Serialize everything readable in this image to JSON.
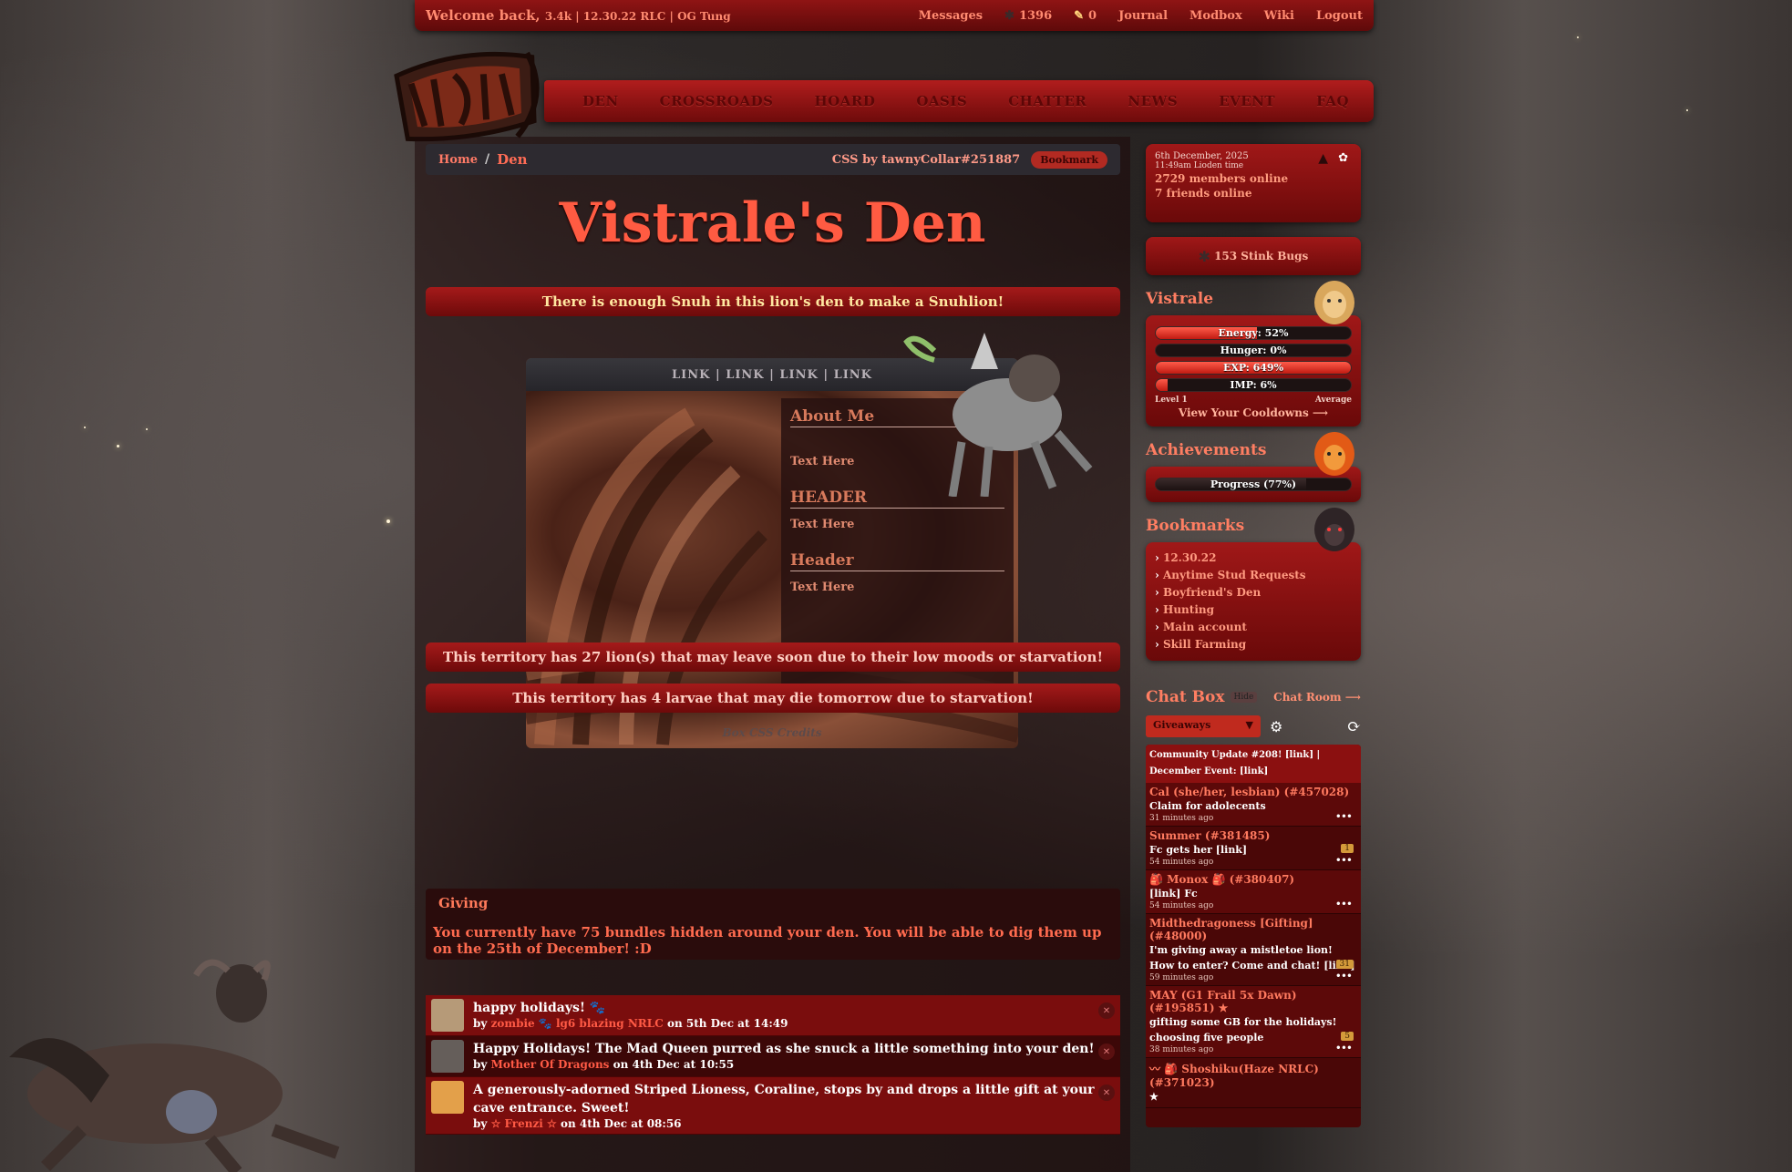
{
  "topbar": {
    "welcome": "Welcome back,",
    "welcome_detail": "3.4k | 12.30.22 RLC | OG Tung",
    "messages": "Messages",
    "stat_count": "1396",
    "feather_count": "0",
    "journal": "Journal",
    "modbox": "Modbox",
    "wiki": "Wiki",
    "logout": "Logout"
  },
  "nav": {
    "items": [
      "DEN",
      "CROSSROADS",
      "HOARD",
      "OASIS",
      "CHATTER",
      "NEWS",
      "EVENT",
      "FAQ"
    ]
  },
  "breadcrumb": {
    "home": "Home",
    "separator": "/",
    "current": "Den",
    "credit": "CSS by tawnyCollar#251887",
    "bookmark": "Bookmark"
  },
  "den": {
    "title": "Vistrale's Den",
    "banner_snuh": "There is enough Snuh in this lion's den to make a Snuhlion!",
    "linkbar": "LINK | LINK | LINK | LINK",
    "panel": {
      "h1": "About Me",
      "t1": "Text Here",
      "h2": "HEADER",
      "t2": "Text Here",
      "h3": "Header",
      "t3": "Text Here"
    },
    "box_credits": "Box CSS Credits",
    "warning_lions": "This territory has 27 lion(s) that may leave soon due to their low moods or starvation!",
    "warning_larvae": "This territory has 4 larvae that may die tomorrow due to starvation!"
  },
  "giving": {
    "title": "Giving",
    "text": "You currently have 75 bundles hidden around your den. You will be able to dig them up on the 25th of December! :D"
  },
  "gift_log": [
    {
      "msg": "happy holidays! 🐾",
      "by": "by",
      "who": "zombie 🐾 lg6 blazing NRLC",
      "when": "on 5th Dec at 14:49"
    },
    {
      "msg": "Happy Holidays! The Mad Queen purred as she snuck a little something into your den!",
      "by": "by",
      "who": "Mother Of Dragons",
      "when": "on 4th Dec at 10:55"
    },
    {
      "msg": "A generously-adorned Striped Lioness, Coraline, stops by and drops a little gift at your cave entrance. Sweet!",
      "by": "by",
      "who": "☆ Frenzi ☆",
      "when": "on 4th Dec at 08:56"
    }
  ],
  "sidebar": {
    "date": "6th December, 2025",
    "time": "11:49am Lioden time",
    "members_online": "2729 members online",
    "friends_online": "7 friends online",
    "stink_bugs": "153 Stink Bugs",
    "lion_name": "Vistrale",
    "bars": [
      {
        "label": "Energy: 52%",
        "pct": 52
      },
      {
        "label": "Hunger: 0%",
        "pct": 0
      },
      {
        "label": "EXP: 649%",
        "pct": 100
      },
      {
        "label": "IMP: 6%",
        "pct": 6
      }
    ],
    "level_left": "Level 1",
    "level_right": "Average",
    "cooldowns": "View Your Cooldowns ⟶",
    "achievements_title": "Achievements",
    "achievements_bar": {
      "label": "Progress (77%)",
      "pct": 77
    },
    "bookmarks_title": "Bookmarks",
    "bookmarks": [
      "12.30.22",
      "Anytime Stud Requests",
      "Boyfriend's Den",
      "Hunting",
      "Main account",
      "Skill Farming"
    ],
    "chat": {
      "title": "Chat Box",
      "hide": "Hide",
      "room": "Chat Room ⟶",
      "channel": "Giveaways",
      "update": "Community Update #208! [link] | December Event: [link]",
      "messages": [
        {
          "name": "Cal (she/her, lesbian) (#457028)",
          "text": "Claim for adolecents",
          "ago": "31 minutes ago",
          "tag": ""
        },
        {
          "name": "Summer (#381485)",
          "text": "Fc gets her [link]",
          "ago": "54 minutes ago",
          "tag": "1"
        },
        {
          "name": "🎒 Monox 🎒 (#380407)",
          "text": "[link] Fc",
          "ago": "54 minutes ago",
          "tag": ""
        },
        {
          "name": "Midthedragoness [Gifting] (#48000)",
          "text": "I'm giving away a mistletoe lion! How to enter? Come and chat! [link]",
          "ago": "59 minutes ago",
          "tag": "31"
        },
        {
          "name": "MAY (G1 Frail 5x Dawn) (#195851) ★",
          "text": "gifting some GB for the holidays! choosing five people",
          "ago": "38 minutes ago",
          "tag": "5"
        },
        {
          "name": "〰 🎒 Shoshiku(Haze NRLC) (#371023)",
          "text": "★",
          "ago": "",
          "tag": ""
        }
      ]
    }
  }
}
